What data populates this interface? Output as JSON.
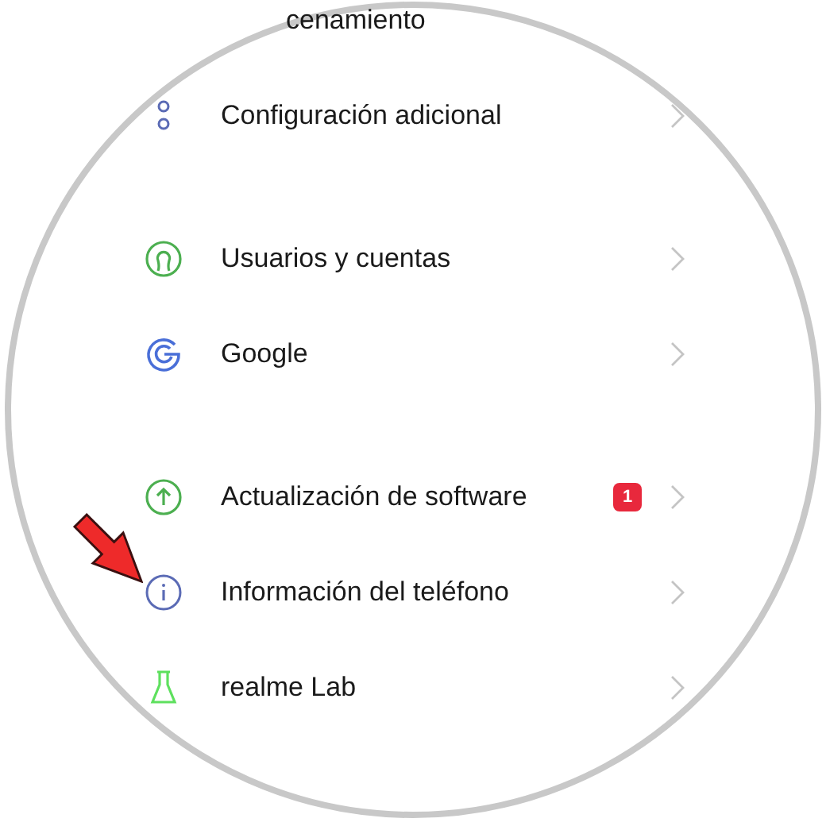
{
  "partial_item": {
    "label": "cenamiento"
  },
  "sections": [
    {
      "items": [
        {
          "kind": "dots",
          "label": "Configuración adicional"
        }
      ]
    },
    {
      "items": [
        {
          "kind": "user",
          "label": "Usuarios y cuentas"
        },
        {
          "kind": "google",
          "label": "Google"
        }
      ]
    },
    {
      "items": [
        {
          "kind": "update",
          "label": "Actualización de software",
          "badge": "1"
        },
        {
          "kind": "info",
          "label": "Información del teléfono",
          "pointed": true
        },
        {
          "kind": "lab",
          "label": "realme Lab"
        }
      ]
    }
  ]
}
